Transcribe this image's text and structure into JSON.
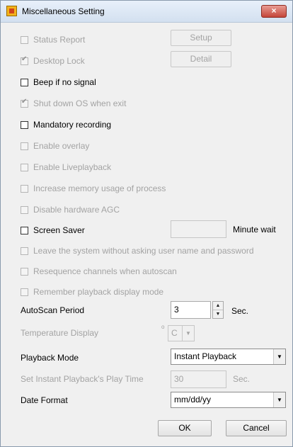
{
  "window": {
    "title": "Miscellaneous Setting",
    "close_glyph": "×"
  },
  "options": {
    "status_report": {
      "label": "Status Report",
      "checked": false,
      "enabled": false
    },
    "desktop_lock": {
      "label": "Desktop Lock",
      "checked": true,
      "enabled": false
    },
    "beep_no_signal": {
      "label": "Beep if no signal",
      "checked": false,
      "enabled": true
    },
    "shutdown_os": {
      "label": "Shut down OS when exit",
      "checked": true,
      "enabled": false
    },
    "mandatory_recording": {
      "label": "Mandatory recording",
      "checked": false,
      "enabled": true
    },
    "enable_overlay": {
      "label": "Enable overlay",
      "checked": false,
      "enabled": false
    },
    "enable_liveplayback": {
      "label": "Enable Liveplayback",
      "checked": false,
      "enabled": false
    },
    "increase_memory": {
      "label": "Increase memory usage of process",
      "checked": false,
      "enabled": false
    },
    "disable_agc": {
      "label": "Disable hardware AGC",
      "checked": false,
      "enabled": false
    },
    "screen_saver": {
      "label": "Screen Saver",
      "checked": false,
      "enabled": true
    },
    "leave_system": {
      "label": "Leave the system without asking user name and password",
      "checked": false,
      "enabled": false
    },
    "resequence": {
      "label": "Resequence channels when autoscan",
      "checked": false,
      "enabled": false
    },
    "remember_playback": {
      "label": "Remember playback display mode",
      "checked": false,
      "enabled": false
    }
  },
  "buttons": {
    "setup": "Setup",
    "detail": "Detail",
    "ok": "OK",
    "cancel": "Cancel"
  },
  "screen_saver": {
    "value": "",
    "unit": "Minute wait"
  },
  "autoscan": {
    "label": "AutoScan Period",
    "value": "3",
    "unit": "Sec."
  },
  "temperature": {
    "label": "Temperature Display",
    "degree": "o",
    "value": "C"
  },
  "playback_mode": {
    "label": "Playback Mode",
    "value": "Instant Playback"
  },
  "instant_time": {
    "label": "Set Instant Playback's Play Time",
    "value": "30",
    "unit": "Sec."
  },
  "date_format": {
    "label": "Date Format",
    "value": "mm/dd/yy"
  },
  "glyphs": {
    "check": "✔",
    "dropdown": "▼",
    "spin_up": "▲",
    "spin_down": "▼"
  }
}
